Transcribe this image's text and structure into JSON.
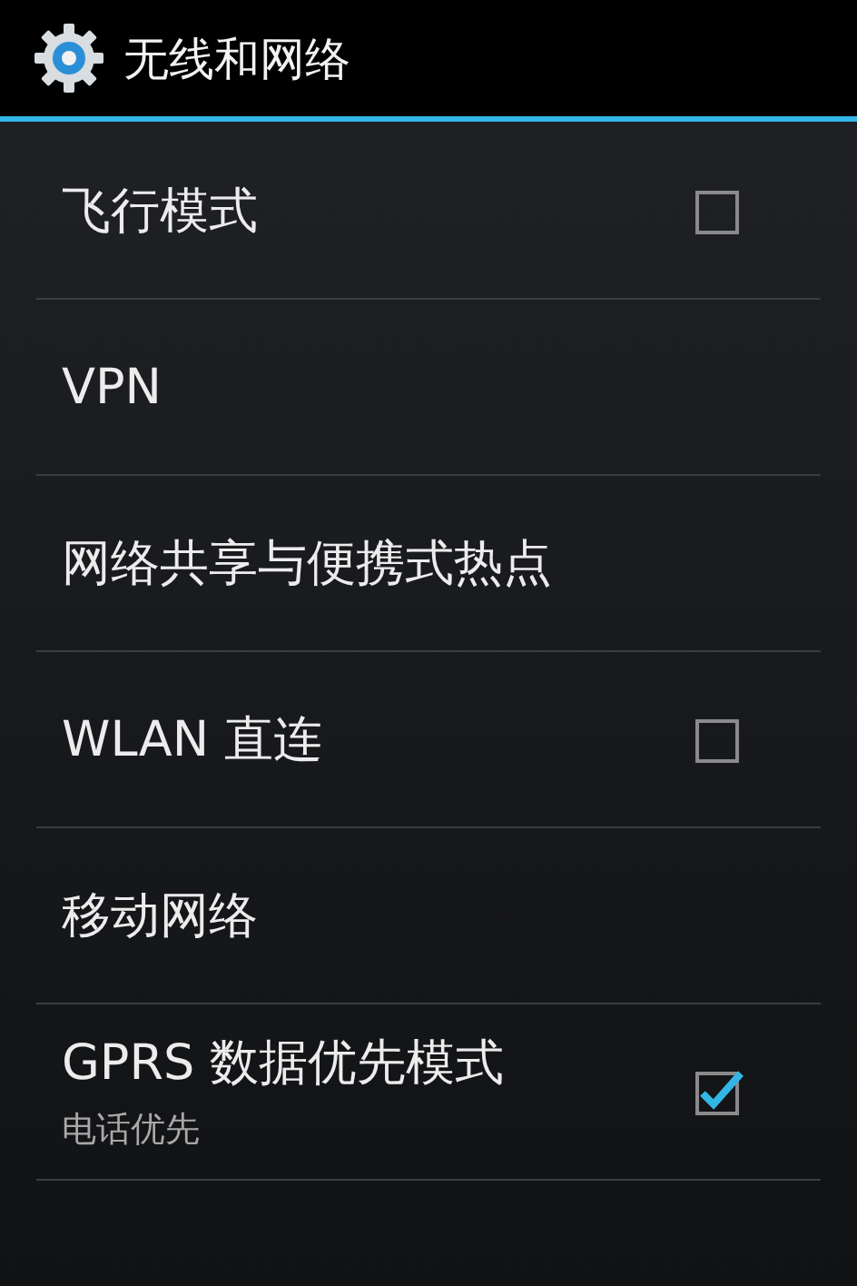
{
  "header": {
    "title": "无线和网络"
  },
  "items": [
    {
      "kind": "checkbox",
      "title": "飞行模式",
      "checked": false
    },
    {
      "kind": "plain",
      "title": "VPN"
    },
    {
      "kind": "plain",
      "title": "网络共享与便携式热点"
    },
    {
      "kind": "checkbox",
      "title": "WLAN 直连",
      "checked": false
    },
    {
      "kind": "plain",
      "title": "移动网络"
    },
    {
      "kind": "checkbox",
      "title": "GPRS 数据优先模式",
      "summary": "电话优先",
      "checked": true
    }
  ]
}
